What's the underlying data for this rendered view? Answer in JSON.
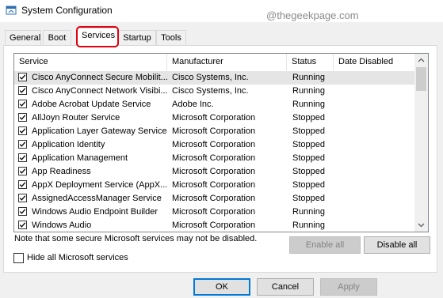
{
  "window": {
    "title": "System Configuration",
    "watermark": "@thegeekpage.com"
  },
  "tabs": [
    {
      "label": "General",
      "active": false
    },
    {
      "label": "Boot",
      "active": false
    },
    {
      "label": "Services",
      "active": true
    },
    {
      "label": "Startup",
      "active": false
    },
    {
      "label": "Tools",
      "active": false
    }
  ],
  "columns": {
    "service": "Service",
    "manufacturer": "Manufacturer",
    "status": "Status",
    "date_disabled": "Date Disabled"
  },
  "services": [
    {
      "name": "Cisco AnyConnect Secure Mobilit...",
      "manufacturer": "Cisco Systems, Inc.",
      "status": "Running",
      "checked": true,
      "selected": true
    },
    {
      "name": "Cisco AnyConnect Network Visibi...",
      "manufacturer": "Cisco Systems, Inc.",
      "status": "Running",
      "checked": true,
      "selected": false
    },
    {
      "name": "Adobe Acrobat Update Service",
      "manufacturer": "Adobe Inc.",
      "status": "Running",
      "checked": true,
      "selected": false
    },
    {
      "name": "AllJoyn Router Service",
      "manufacturer": "Microsoft Corporation",
      "status": "Stopped",
      "checked": true,
      "selected": false
    },
    {
      "name": "Application Layer Gateway Service",
      "manufacturer": "Microsoft Corporation",
      "status": "Stopped",
      "checked": true,
      "selected": false
    },
    {
      "name": "Application Identity",
      "manufacturer": "Microsoft Corporation",
      "status": "Stopped",
      "checked": true,
      "selected": false
    },
    {
      "name": "Application Management",
      "manufacturer": "Microsoft Corporation",
      "status": "Stopped",
      "checked": true,
      "selected": false
    },
    {
      "name": "App Readiness",
      "manufacturer": "Microsoft Corporation",
      "status": "Stopped",
      "checked": true,
      "selected": false
    },
    {
      "name": "AppX Deployment Service (AppX...",
      "manufacturer": "Microsoft Corporation",
      "status": "Stopped",
      "checked": true,
      "selected": false
    },
    {
      "name": "AssignedAccessManager Service",
      "manufacturer": "Microsoft Corporation",
      "status": "Stopped",
      "checked": true,
      "selected": false
    },
    {
      "name": "Windows Audio Endpoint Builder",
      "manufacturer": "Microsoft Corporation",
      "status": "Running",
      "checked": true,
      "selected": false
    },
    {
      "name": "Windows Audio",
      "manufacturer": "Microsoft Corporation",
      "status": "Running",
      "checked": true,
      "selected": false
    }
  ],
  "note": "Note that some secure Microsoft services may not be disabled.",
  "buttons": {
    "enable_all": "Enable all",
    "disable_all": "Disable all",
    "ok": "OK",
    "cancel": "Cancel",
    "apply": "Apply"
  },
  "hide_ms": {
    "label": "Hide all Microsoft services",
    "checked": false
  },
  "colors": {
    "highlight": "#e0000f",
    "selected_row": "#e5e5e5"
  }
}
